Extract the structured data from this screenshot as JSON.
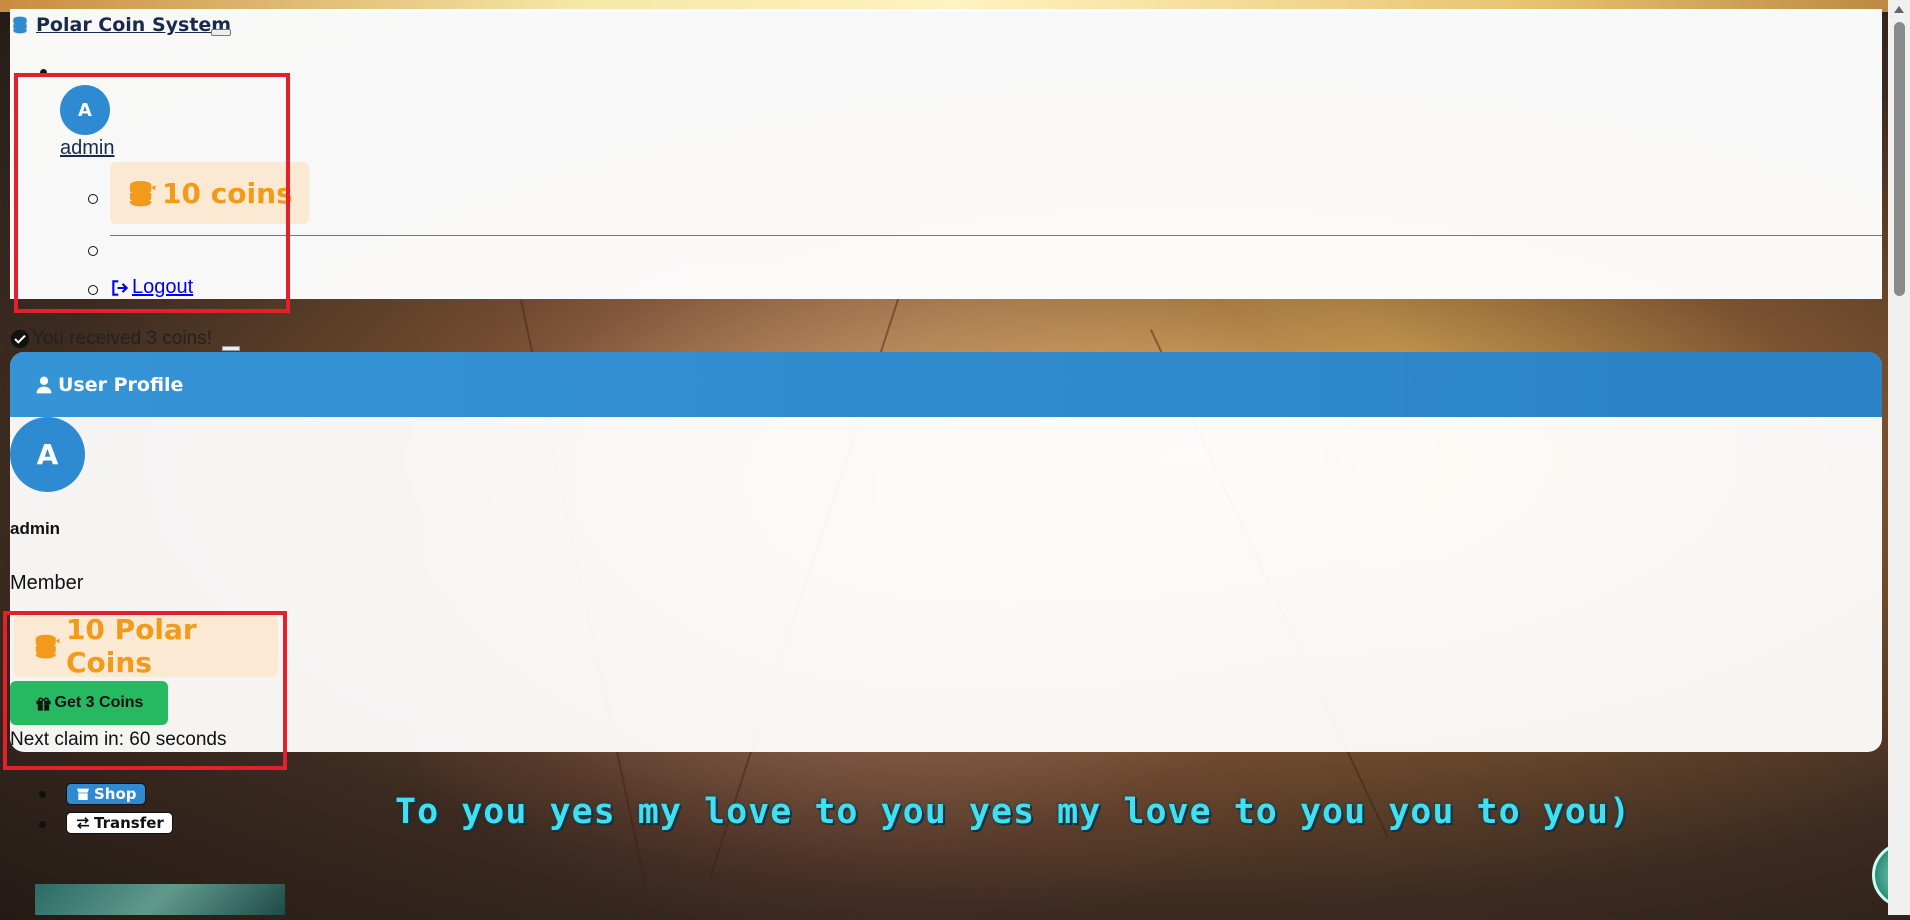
{
  "navbar": {
    "brand_label": "Polar Coin System",
    "user": {
      "avatar_initial": "A",
      "username": "admin"
    },
    "coin_balance_label": "10 coins",
    "logout_label": "Logout"
  },
  "alert": {
    "message": "You received 3 coins!"
  },
  "profile": {
    "header_title": "User Profile",
    "avatar_initial": "A",
    "username": "admin",
    "role": "Member",
    "coins_label": "10 Polar Coins",
    "claim_button_label": "Get 3 Coins",
    "next_claim_text": "Next claim in: 60 seconds"
  },
  "links": {
    "shop_label": "Shop",
    "transfer_label": "Transfer"
  },
  "video_subtitle": "To you yes my love to you yes my love to you you to you)",
  "colors": {
    "accent_blue": "#2f8bd1",
    "coin_orange": "#f29a1a",
    "success_green": "#27b862",
    "annotation_red": "#e3202b"
  },
  "icons": [
    "coins-icon",
    "logout-icon",
    "check-circle-icon",
    "user-icon",
    "gift-icon",
    "store-icon",
    "exchange-icon"
  ]
}
